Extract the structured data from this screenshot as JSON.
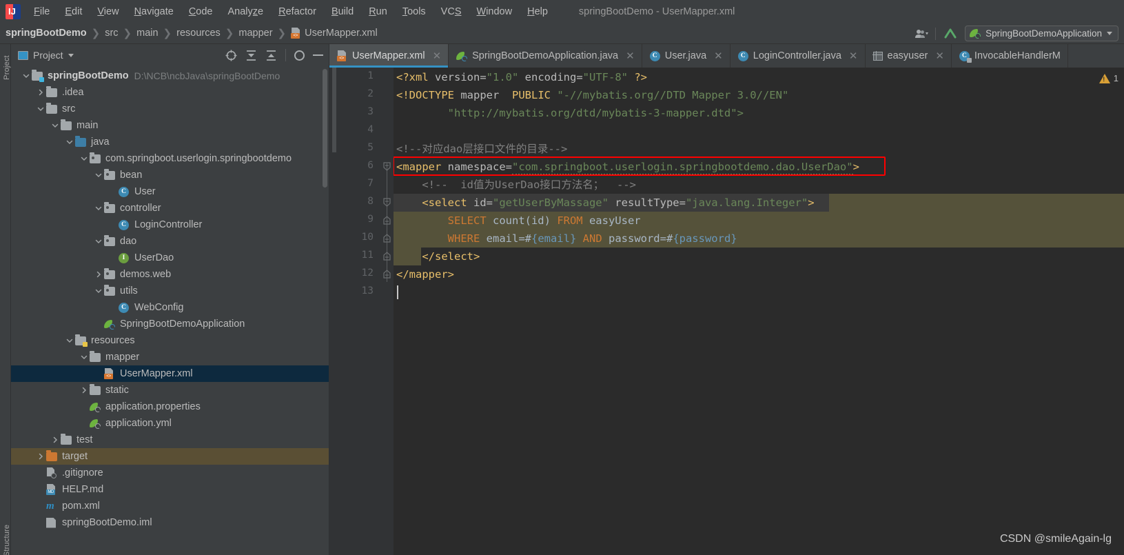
{
  "window": {
    "title": "springBootDemo - UserMapper.xml"
  },
  "menubar": {
    "items": [
      {
        "label": "File",
        "mnemonic": "F"
      },
      {
        "label": "Edit",
        "mnemonic": "E"
      },
      {
        "label": "View",
        "mnemonic": "V"
      },
      {
        "label": "Navigate",
        "mnemonic": "N"
      },
      {
        "label": "Code",
        "mnemonic": "C"
      },
      {
        "label": "Analyze",
        "mnemonic": "z"
      },
      {
        "label": "Refactor",
        "mnemonic": "R"
      },
      {
        "label": "Build",
        "mnemonic": "B"
      },
      {
        "label": "Run",
        "mnemonic": "R"
      },
      {
        "label": "Tools",
        "mnemonic": "T"
      },
      {
        "label": "VCS",
        "mnemonic": "S"
      },
      {
        "label": "Window",
        "mnemonic": "W"
      },
      {
        "label": "Help",
        "mnemonic": "H"
      }
    ]
  },
  "breadcrumb": {
    "items": [
      "springBootDemo",
      "src",
      "main",
      "resources",
      "mapper"
    ],
    "file": "UserMapper.xml",
    "separator": "❯"
  },
  "toolbar_right": {
    "run_config": "SpringBootDemoApplication",
    "icons": [
      "user-group-icon",
      "update-project-icon",
      "spring-boot-icon",
      "chevron-down-icon"
    ]
  },
  "tool_strip": {
    "top_label": "Project",
    "bottom_label": "Structure"
  },
  "project_panel": {
    "title": "Project",
    "tools": [
      "locate-icon",
      "expand-all-icon",
      "collapse-all-icon",
      "gear-icon",
      "hide-icon"
    ],
    "tree": [
      {
        "depth": 0,
        "label": "springBootDemo",
        "path": "D:\\NCB\\ncbJava\\springBootDemo",
        "icon": "module-folder",
        "arrow": "open",
        "bold": true
      },
      {
        "depth": 1,
        "label": ".idea",
        "icon": "folder",
        "arrow": "closed"
      },
      {
        "depth": 1,
        "label": "src",
        "icon": "folder",
        "arrow": "open"
      },
      {
        "depth": 2,
        "label": "main",
        "icon": "folder",
        "arrow": "open"
      },
      {
        "depth": 3,
        "label": "java",
        "icon": "folder-blue",
        "arrow": "open"
      },
      {
        "depth": 4,
        "label": "com.springboot.userlogin.springbootdemo",
        "icon": "package",
        "arrow": "open"
      },
      {
        "depth": 5,
        "label": "bean",
        "icon": "package",
        "arrow": "open"
      },
      {
        "depth": 6,
        "label": "User",
        "icon": "class"
      },
      {
        "depth": 5,
        "label": "controller",
        "icon": "package",
        "arrow": "open"
      },
      {
        "depth": 6,
        "label": "LoginController",
        "icon": "class"
      },
      {
        "depth": 5,
        "label": "dao",
        "icon": "package",
        "arrow": "open"
      },
      {
        "depth": 6,
        "label": "UserDao",
        "icon": "interface"
      },
      {
        "depth": 5,
        "label": "demos.web",
        "icon": "package",
        "arrow": "closed"
      },
      {
        "depth": 5,
        "label": "utils",
        "icon": "package",
        "arrow": "open"
      },
      {
        "depth": 6,
        "label": "WebConfig",
        "icon": "class"
      },
      {
        "depth": 5,
        "label": "SpringBootDemoApplication",
        "icon": "spring"
      },
      {
        "depth": 3,
        "label": "resources",
        "icon": "resource-folder",
        "arrow": "open"
      },
      {
        "depth": 4,
        "label": "mapper",
        "icon": "folder",
        "arrow": "open"
      },
      {
        "depth": 5,
        "label": "UserMapper.xml",
        "icon": "xml",
        "selected": true
      },
      {
        "depth": 4,
        "label": "static",
        "icon": "folder",
        "arrow": "closed"
      },
      {
        "depth": 4,
        "label": "application.properties",
        "icon": "spring-config"
      },
      {
        "depth": 4,
        "label": "application.yml",
        "icon": "spring-config"
      },
      {
        "depth": 2,
        "label": "test",
        "icon": "folder",
        "arrow": "closed"
      },
      {
        "depth": 1,
        "label": "target",
        "icon": "folder-orange",
        "arrow": "closed",
        "highlight": true
      },
      {
        "depth": 1,
        "label": ".gitignore",
        "icon": "gitignore"
      },
      {
        "depth": 1,
        "label": "HELP.md",
        "icon": "markdown"
      },
      {
        "depth": 1,
        "label": "pom.xml",
        "icon": "maven"
      },
      {
        "depth": 1,
        "label": "springBootDemo.iml",
        "icon": "iml"
      }
    ]
  },
  "editor_tabs": [
    {
      "label": "UserMapper.xml",
      "icon": "xml-file-icon",
      "active": true,
      "closable": true
    },
    {
      "label": "SpringBootDemoApplication.java",
      "icon": "spring-class-icon",
      "active": false,
      "closable": true
    },
    {
      "label": "User.java",
      "icon": "java-class-icon",
      "active": false,
      "closable": true
    },
    {
      "label": "LoginController.java",
      "icon": "java-class-icon",
      "active": false,
      "closable": true
    },
    {
      "label": "easyuser",
      "icon": "db-table-icon",
      "active": false,
      "closable": true
    },
    {
      "label": "InvocableHandlerM",
      "icon": "java-class-readonly-icon",
      "active": false,
      "closable": false
    }
  ],
  "editor": {
    "line_numbers": [
      "1",
      "2",
      "3",
      "4",
      "5",
      "6",
      "7",
      "8",
      "9",
      "10",
      "11",
      "12",
      "13"
    ],
    "warning_count": "1",
    "warning_icon": "warning-triangle-icon",
    "lines": [
      {
        "n": 1,
        "tokens": [
          {
            "t": "<?xml",
            "c": "t-pi"
          },
          {
            "t": " version=",
            "c": "t-attr"
          },
          {
            "t": "\"1.0\"",
            "c": "t-str"
          },
          {
            "t": " encoding=",
            "c": "t-attr"
          },
          {
            "t": "\"UTF-8\"",
            "c": "t-str"
          },
          {
            "t": " ",
            "c": "t-attr"
          },
          {
            "t": "?>",
            "c": "t-pi"
          }
        ]
      },
      {
        "n": 2,
        "tokens": [
          {
            "t": "<!DOCTYPE",
            "c": "t-pi"
          },
          {
            "t": " mapper  ",
            "c": "t-attr"
          },
          {
            "t": "PUBLIC",
            "c": "t-pi"
          },
          {
            "t": " ",
            "c": "t-attr"
          },
          {
            "t": "\"-//mybatis.org//DTD Mapper 3.0//EN\"",
            "c": "t-str"
          }
        ]
      },
      {
        "n": 3,
        "tokens": [
          {
            "t": "        \"http://mybatis.org/dtd/mybatis-3-mapper.dtd\">",
            "c": "t-str"
          }
        ]
      },
      {
        "n": 4,
        "tokens": []
      },
      {
        "n": 5,
        "tokens": [
          {
            "t": "<!--对应dao层接口文件的目录-->",
            "c": "t-cmt"
          }
        ]
      },
      {
        "n": 6,
        "tokens": [
          {
            "t": "<mapper",
            "c": "t-tag"
          },
          {
            "t": " namespace=",
            "c": "t-attr"
          },
          {
            "t": "\"com.springboot.userlogin.springbootdemo.dao.UserDao\"",
            "c": "t-str"
          },
          {
            "t": ">",
            "c": "t-tag"
          }
        ],
        "boxed": true
      },
      {
        "n": 7,
        "tokens": [
          {
            "t": "    <!--  id值为UserDao接口方法名；  -->",
            "c": "t-cmt"
          }
        ]
      },
      {
        "n": 8,
        "tokens": [
          {
            "t": "    <select",
            "c": "t-tag"
          },
          {
            "t": " id=",
            "c": "t-attr"
          },
          {
            "t": "\"getUserByMassage\"",
            "c": "t-str"
          },
          {
            "t": " resultType=",
            "c": "t-attr"
          },
          {
            "t": "\"java.lang.Integer\"",
            "c": "t-str"
          },
          {
            "t": ">",
            "c": "t-tag"
          }
        ]
      },
      {
        "n": 9,
        "tokens": [
          {
            "t": "        ",
            "c": "t-plain"
          },
          {
            "t": "SELECT",
            "c": "t-kw"
          },
          {
            "t": " count(id) ",
            "c": "t-plain"
          },
          {
            "t": "FROM",
            "c": "t-kw"
          },
          {
            "t": " easyUser",
            "c": "t-plain"
          }
        ]
      },
      {
        "n": 10,
        "tokens": [
          {
            "t": "        ",
            "c": "t-plain"
          },
          {
            "t": "WHERE",
            "c": "t-kw"
          },
          {
            "t": " email=#",
            "c": "t-plain"
          },
          {
            "t": "{email}",
            "c": "t-brace"
          },
          {
            "t": " ",
            "c": "t-plain"
          },
          {
            "t": "AND",
            "c": "t-kw"
          },
          {
            "t": " password=#",
            "c": "t-plain"
          },
          {
            "t": "{password}",
            "c": "t-brace"
          }
        ]
      },
      {
        "n": 11,
        "tokens": [
          {
            "t": "    </select>",
            "c": "t-tag"
          }
        ]
      },
      {
        "n": 12,
        "tokens": [
          {
            "t": "</mapper>",
            "c": "t-tag"
          }
        ]
      },
      {
        "n": 13,
        "tokens": []
      }
    ]
  },
  "watermark": "CSDN @smileAgain-lg",
  "colors": {
    "chrome": "#3c3f41",
    "editor_bg": "#2b2b2b",
    "gutter_bg": "#313335",
    "accent": "#3592c4",
    "selection": "#0d293e",
    "highlight_block": "#55523a",
    "target_row": "#5a4f34",
    "red_box": "#ff0000",
    "string": "#6a8759",
    "tag": "#e8bf6a",
    "keyword": "#cc7832"
  }
}
